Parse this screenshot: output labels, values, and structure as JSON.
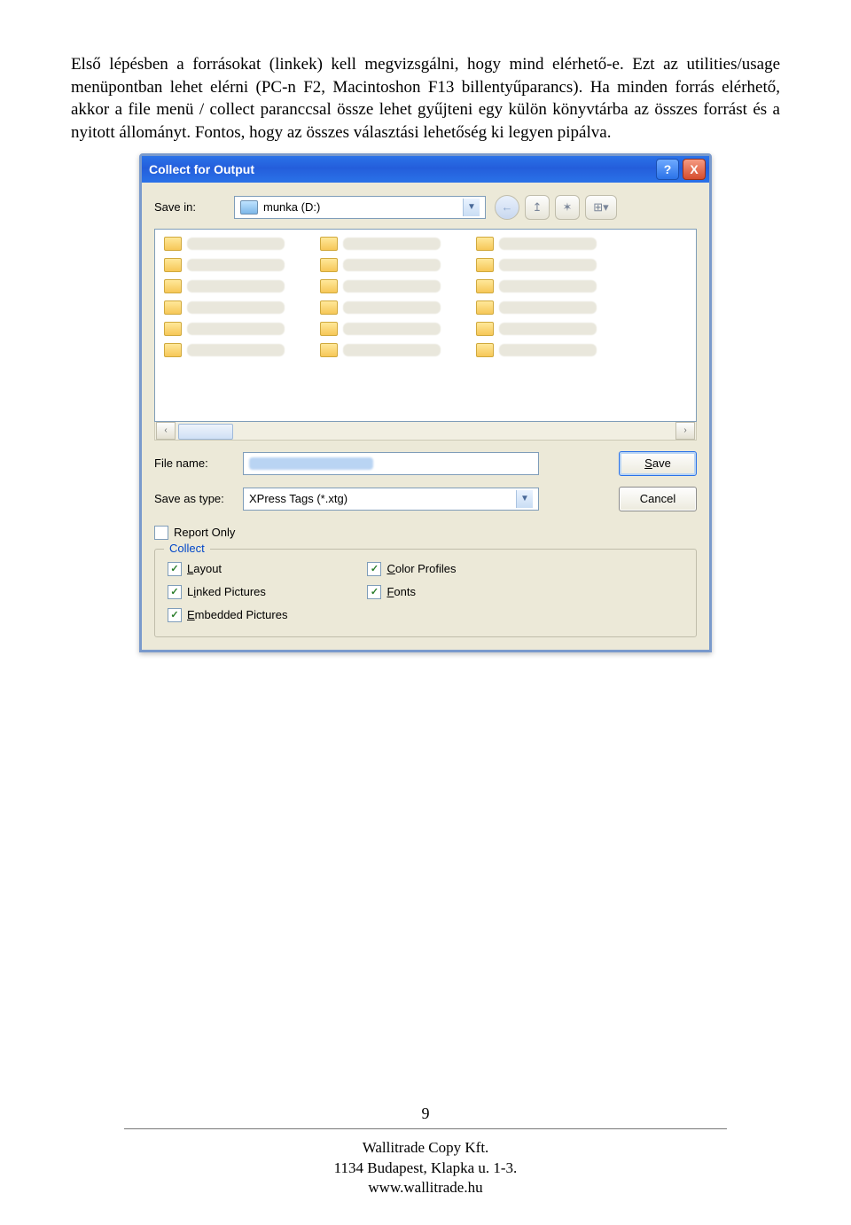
{
  "body_text": "Első lépésben a forrásokat (linkek) kell megvizsgálni, hogy mind elérhető-e. Ezt az utilities/usage menüpontban lehet elérni (PC-n F2, Macintoshon F13 billentyűparancs). Ha minden forrás elérhető, akkor a file menü / collect paranccsal össze lehet gyűjteni egy külön könyvtárba az összes forrást és a nyitott állományt. Fontos, hogy az összes választási lehetőség ki legyen pipálva.",
  "dialog": {
    "title": "Collect for Output",
    "help": "?",
    "close": "X",
    "save_in_label": "Save in:",
    "save_in_value": "munka (D:)",
    "nav_back": "←",
    "nav_up": "↥",
    "nav_new": "✶",
    "nav_views": "⊞▾",
    "scroll_left": "‹",
    "scroll_right": "›",
    "file_name_label": "File name:",
    "save_as_type_label": "Save as type:",
    "save_as_type_value": "XPress Tags (*.xtg)",
    "save_btn_pre": "",
    "save_btn_u": "S",
    "save_btn_post": "ave",
    "cancel_btn": "Cancel",
    "report_only": "Report Only",
    "collect_group": "Collect",
    "layout_u": "L",
    "layout_post": "ayout",
    "linked_u": "i",
    "linked_pre": "L",
    "linked_post": "nked Pictures",
    "embedded_u": "E",
    "embedded_post": "mbedded Pictures",
    "color_u": "C",
    "color_post": "olor Profiles",
    "fonts_u": "F",
    "fonts_post": "onts",
    "check": "✓"
  },
  "footer": {
    "page": "9",
    "l1": "Wallitrade Copy Kft.",
    "l2": "1134 Budapest, Klapka u. 1-3.",
    "l3": "www.wallitrade.hu"
  }
}
